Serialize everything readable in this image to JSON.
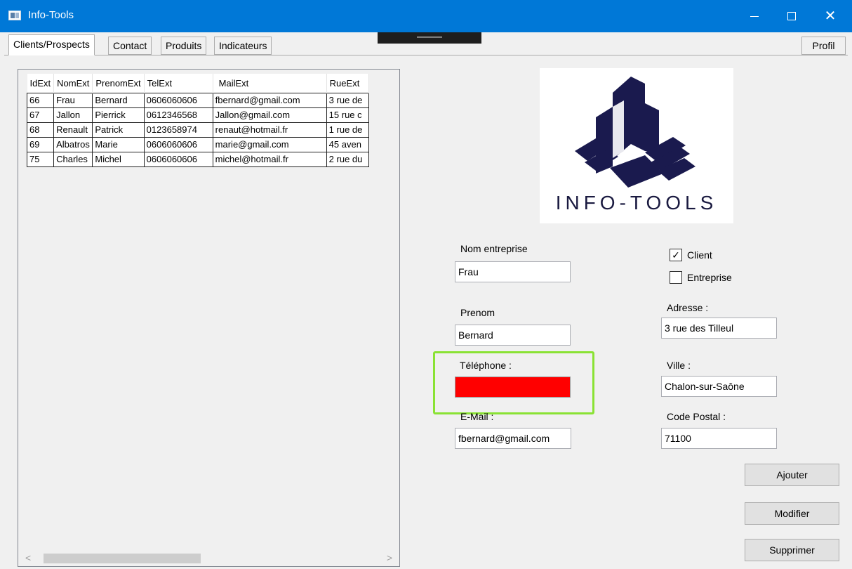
{
  "window": {
    "title": "Info-Tools"
  },
  "tabs": [
    "Clients/Prospects",
    "Contact",
    "Produits",
    "Indicateurs"
  ],
  "profil_label": "Profil",
  "grid": {
    "columns": [
      "IdExt",
      "NomExt",
      "PrenomExt",
      "TelExt",
      "MailExt",
      "RueExt"
    ],
    "rows": [
      [
        "66",
        "Frau",
        "Bernard",
        "0606060606",
        "fbernard@gmail.com",
        "3 rue de"
      ],
      [
        "67",
        "Jallon",
        "Pierrick",
        "0612346568",
        "Jallon@gmail.com",
        "15 rue c"
      ],
      [
        "68",
        "Renault",
        "Patrick",
        "0123658974",
        "renaut@hotmail.fr",
        "1 rue de"
      ],
      [
        "69",
        "Albatros",
        "Marie",
        "0606060606",
        "marie@gmail.com",
        "45 aven"
      ],
      [
        "75",
        "Charles",
        "Michel",
        "0606060606",
        "michel@hotmail.fr",
        "2 rue du"
      ]
    ]
  },
  "logo": {
    "text": "INFO-TOOLS",
    "color": "#1a1a4e"
  },
  "form": {
    "nom_label": "Nom entreprise",
    "nom_value": "Frau",
    "prenom_label": "Prenom",
    "prenom_value": "Bernard",
    "telephone_label": "Téléphone :",
    "telephone_value": "",
    "telephone_bg": "#ff0000",
    "email_label": "E-Mail :",
    "email_value": "fbernard@gmail.com",
    "client_label": "Client",
    "client_checked": true,
    "entreprise_label": "Entreprise",
    "entreprise_checked": false,
    "adresse_label": "Adresse :",
    "adresse_value": "3 rue des Tilleul",
    "ville_label": "Ville :",
    "ville_value": "Chalon-sur-Saône",
    "cp_label": "Code Postal :",
    "cp_value": "71100"
  },
  "buttons": {
    "ajouter": "Ajouter",
    "modifier": "Modifier",
    "supprimer": "Supprimer"
  },
  "highlight_color": "#8ae234"
}
